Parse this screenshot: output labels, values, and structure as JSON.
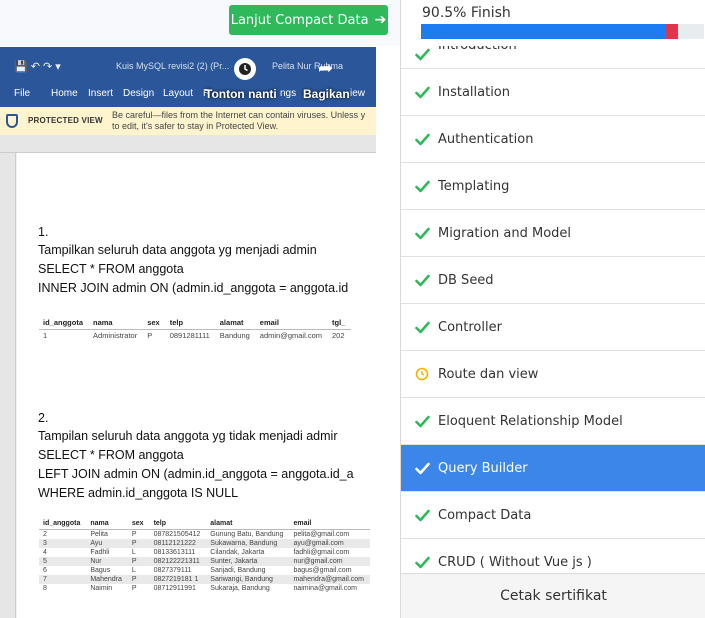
{
  "next_button": {
    "label": "Lanjut Compact Data",
    "icon": "arrow-right-icon"
  },
  "video": {
    "doc_title": "Kuis MySQL revisi2 (2) (Pr...",
    "user_name": "Pelita Nur Ruhma",
    "ribbon_tabs": [
      "File",
      "Home",
      "Insert",
      "Design",
      "Layout",
      "R",
      "ngs",
      "iew"
    ],
    "overlay_watch_later": "Tonton nanti",
    "overlay_share": "Bagikan",
    "protected_view_label": "PROTECTED VIEW",
    "protected_view_msg_1": "Be careful—files from the Internet can contain viruses. Unless y",
    "protected_view_msg_2": "to edit, it's safer to stay in Protected View.",
    "q1_num": "1.",
    "q1_line1": "Tampilkan seluruh data anggota yg menjadi admin",
    "q1_line2": "SELECT * FROM anggota",
    "q1_line3": "INNER JOIN admin ON (admin.id_anggota = anggota.id",
    "table1_headers": [
      "id_anggota",
      "nama",
      "sex",
      "telp",
      "alamat",
      "email",
      "tgl_"
    ],
    "table1_rows": [
      [
        "1",
        "Administrator",
        "P",
        "0891281111",
        "Bandung",
        "admin@gmail.com",
        "202"
      ]
    ],
    "q2_num": "2.",
    "q2_line1": "Tampilan seluruh data anggota yg tidak menjadi admir",
    "q2_line2": "SELECT * FROM anggota",
    "q2_line3": "LEFT JOIN admin ON (admin.id_anggota = anggota.id_a",
    "q2_line4": "WHERE admin.id_anggota IS NULL",
    "table2_headers": [
      "id_anggota",
      "nama",
      "sex",
      "telp",
      "alamat",
      "email"
    ],
    "table2_rows": [
      [
        "2",
        "Pelita",
        "P",
        "087821505412",
        "Gunung Batu, Bandung",
        "pelita@gmail.com"
      ],
      [
        "3",
        "Ayu",
        "P",
        "08112121222",
        "Sukawarna, Bandung",
        "ayu@gmail.com"
      ],
      [
        "4",
        "Fadhli",
        "L",
        "08133613111",
        "Cilandak, Jakarta",
        "fadhli@gmail.com"
      ],
      [
        "5",
        "Nur",
        "P",
        "082122221311",
        "Sunter, Jakarta",
        "nur@gmail.com"
      ],
      [
        "6",
        "Bagus",
        "L",
        "0827379111",
        "Sarijadi, Bandung",
        "bagus@gmail.com"
      ],
      [
        "7",
        "Mahendra",
        "P",
        "0827219181 1",
        "Sariwangi, Bandung",
        "mahendra@gmail.com"
      ],
      [
        "8",
        "Naimin",
        "P",
        "08712911991",
        "Sukaraja, Bandung",
        "naimina@gmail.com"
      ]
    ]
  },
  "sidebar": {
    "progress_text": "90.5% Finish",
    "progress_value": 0.905,
    "colors": {
      "progress": "#1e7cf2",
      "remaining_marker": "#e0354b",
      "done": "#2fb95a",
      "in_progress": "#f0b400",
      "active": "#3b86e8"
    },
    "lessons": [
      {
        "label": "Introduction",
        "status": "done"
      },
      {
        "label": "Installation",
        "status": "done"
      },
      {
        "label": "Authentication",
        "status": "done"
      },
      {
        "label": "Templating",
        "status": "done"
      },
      {
        "label": "Migration and Model",
        "status": "done"
      },
      {
        "label": "DB Seed",
        "status": "done"
      },
      {
        "label": "Controller",
        "status": "done"
      },
      {
        "label": "Route dan view",
        "status": "in-progress"
      },
      {
        "label": "Eloquent Relationship Model",
        "status": "done"
      },
      {
        "label": "Query Builder",
        "status": "active"
      },
      {
        "label": "Compact Data",
        "status": "done"
      },
      {
        "label": "CRUD ( Without Vue js )",
        "status": "done"
      }
    ],
    "footer_label": "Cetak sertifikat"
  }
}
